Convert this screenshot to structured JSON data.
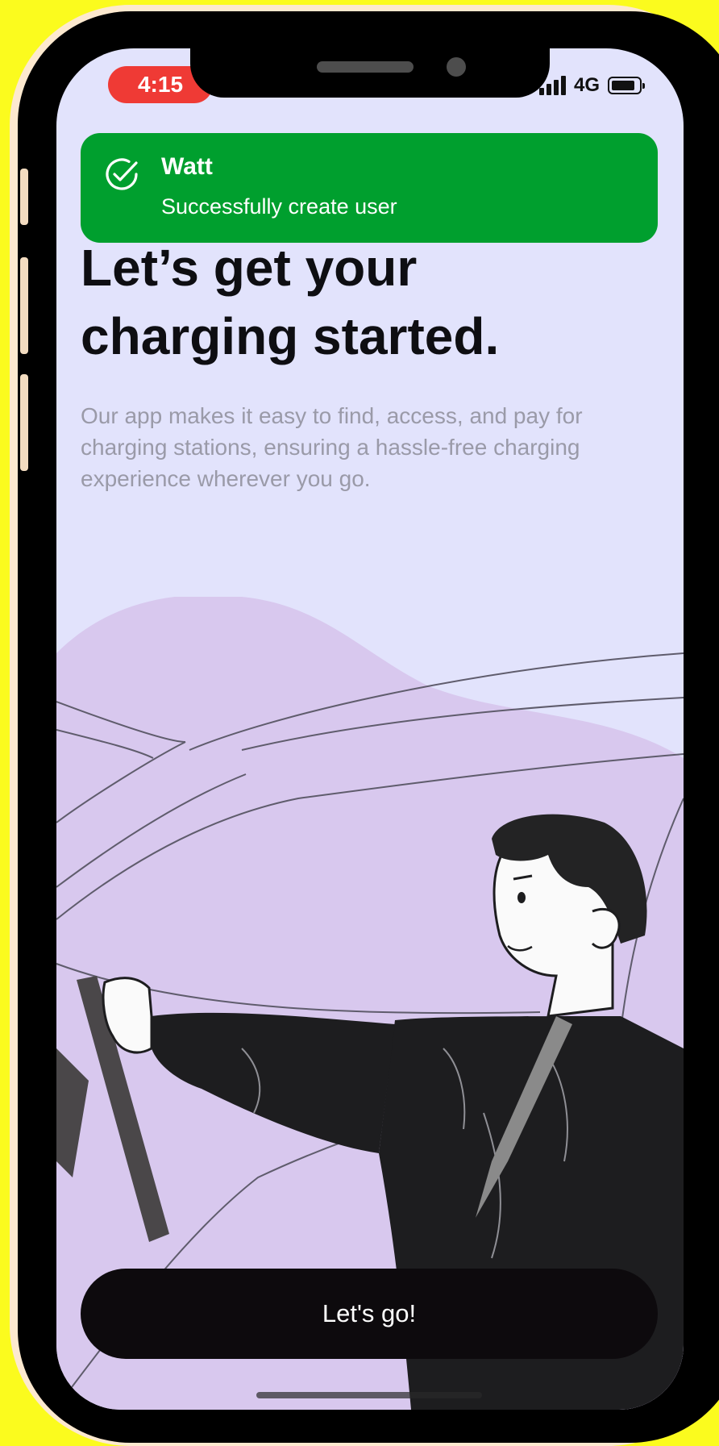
{
  "status_bar": {
    "time": "4:15",
    "network": "4G"
  },
  "toast": {
    "title": "Watt",
    "message": "Successfully create user",
    "icon": "check-circle-icon",
    "color": "#009f2e"
  },
  "onboarding": {
    "heading_line1": "Let’s get your",
    "heading_line2": "charging started.",
    "description": "Our app makes it easy to find, access, and pay for charging stations, ensuring a hassle-free charging experience wherever you go.",
    "illustration": "man-driving-car-illustration"
  },
  "cta": {
    "label": "Let's go!"
  },
  "colors": {
    "background": "#e2e3fc",
    "blob": "#d8c8ee",
    "button": "#0d0a0d",
    "time_pill": "#ef3a35"
  }
}
